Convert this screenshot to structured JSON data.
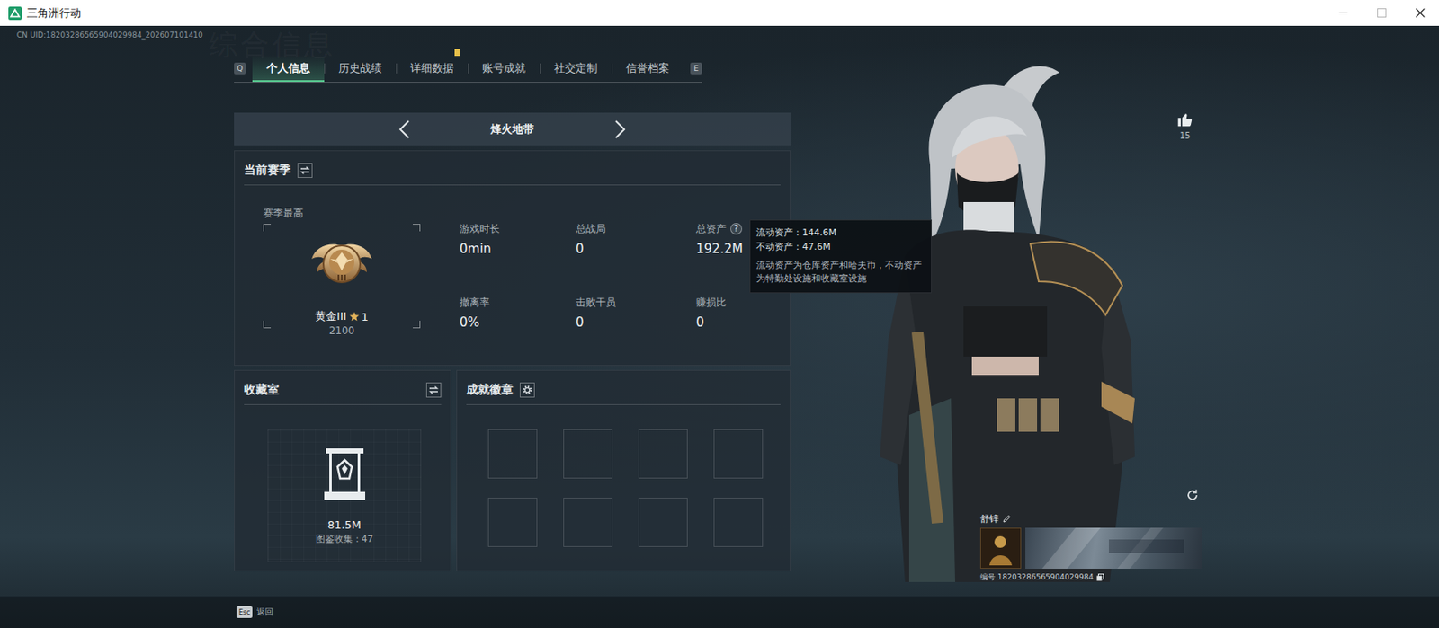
{
  "window": {
    "title": "三角洲行动"
  },
  "header": {
    "uid": "CN UID:18203286565904029984_202607101410",
    "watermark": "综合信息"
  },
  "tab_keys": {
    "prev": "Q",
    "next": "E"
  },
  "tabs": [
    {
      "label": "个人信息",
      "selected": true,
      "notify": false
    },
    {
      "label": "历史战绩",
      "selected": false,
      "notify": false
    },
    {
      "label": "详细数据",
      "selected": false,
      "notify": true
    },
    {
      "label": "账号成就",
      "selected": false,
      "notify": false
    },
    {
      "label": "社交定制",
      "selected": false,
      "notify": false
    },
    {
      "label": "信誉档案",
      "selected": false,
      "notify": false
    }
  ],
  "mode": {
    "label": "烽火地带"
  },
  "season": {
    "title": "当前赛季",
    "best_label": "赛季最高",
    "rank": "黄金III",
    "star_count": "1",
    "score": "2100",
    "stats": [
      {
        "label": "游戏时长",
        "value": "0min"
      },
      {
        "label": "总战局",
        "value": "0"
      },
      {
        "label": "总资产",
        "value": "192.2M",
        "help": "?"
      },
      {
        "label": "撤离率",
        "value": "0%"
      },
      {
        "label": "击败干员",
        "value": "0"
      },
      {
        "label": "赚损比",
        "value": "0"
      }
    ]
  },
  "tooltip": {
    "lines": [
      "流动资产：144.6M",
      "不动资产：47.6M"
    ],
    "note": "流动资产为仓库资产和哈夫币，不动资产为特勤处设施和收藏室设施"
  },
  "collection": {
    "title": "收藏室",
    "value": "81.5M",
    "catalog": "图鉴收集：47"
  },
  "achievements": {
    "title": "成就徽章",
    "slots": [
      {
        "filled": false
      },
      {
        "filled": false
      },
      {
        "filled": false
      },
      {
        "filled": false
      },
      {
        "filled": false
      },
      {
        "filled": false
      },
      {
        "filled": false
      },
      {
        "filled": false
      }
    ]
  },
  "likes": {
    "count": "15"
  },
  "player": {
    "name": "舒锌",
    "id": "编号 18203286565904029984"
  },
  "footer": {
    "key": "Esc",
    "label": "返回"
  }
}
